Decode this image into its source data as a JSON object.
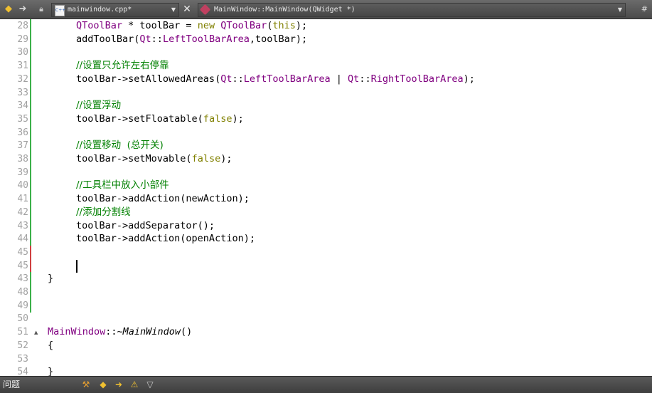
{
  "toolbar": {
    "back_icon": "back-arrow-icon",
    "forward_icon": "forward-arrow-icon",
    "lock_icon": "lock-icon",
    "file_name": "mainwindow.cpp*",
    "file_icon_text": "C++",
    "close_label": "✕",
    "method_name": "MainWindow::MainWindow(QWidget *)",
    "symbol_menu": "#"
  },
  "editor": {
    "lines": [
      {
        "n": "28",
        "mark": "#3cb04a",
        "fold": "",
        "html": "<span class=\"type\">QToolBar</span> * toolBar = <span class=\"kw\">new</span> <span class=\"type\">QToolBar</span>(<span class=\"kw\">this</span>);",
        "indent": true
      },
      {
        "n": "29",
        "mark": "#3cb04a",
        "fold": "",
        "html": "addToolBar(<span class=\"enum\">Qt</span>::<span class=\"enum\">LeftToolBarArea</span>,toolBar);",
        "indent": true
      },
      {
        "n": "30",
        "mark": "#3cb04a",
        "fold": "",
        "html": "",
        "indent": true
      },
      {
        "n": "31",
        "mark": "#3cb04a",
        "fold": "",
        "html": "<span class=\"comment\">//设置只允许左右停靠</span>",
        "indent": true
      },
      {
        "n": "32",
        "mark": "#3cb04a",
        "fold": "",
        "html": "toolBar->setAllowedAreas(<span class=\"enum\">Qt</span>::<span class=\"enum\">LeftToolBarArea</span> | <span class=\"enum\">Qt</span>::<span class=\"enum\">RightToolBarArea</span>);",
        "indent": true
      },
      {
        "n": "33",
        "mark": "#3cb04a",
        "fold": "",
        "html": "",
        "indent": true
      },
      {
        "n": "34",
        "mark": "#3cb04a",
        "fold": "",
        "html": "<span class=\"comment\">//设置浮动</span>",
        "indent": true
      },
      {
        "n": "35",
        "mark": "#3cb04a",
        "fold": "",
        "html": "toolBar->setFloatable(<span class=\"kw\">false</span>);",
        "indent": true
      },
      {
        "n": "36",
        "mark": "#3cb04a",
        "fold": "",
        "html": "",
        "indent": true
      },
      {
        "n": "37",
        "mark": "#3cb04a",
        "fold": "",
        "html": "<span class=\"comment\">//设置移动  (总开关)</span>",
        "indent": true
      },
      {
        "n": "38",
        "mark": "#3cb04a",
        "fold": "",
        "html": "toolBar->setMovable(<span class=\"kw\">false</span>);",
        "indent": true
      },
      {
        "n": "39",
        "mark": "#3cb04a",
        "fold": "",
        "html": "",
        "indent": true
      },
      {
        "n": "40",
        "mark": "#3cb04a",
        "fold": "",
        "html": "<span class=\"comment\">//工具栏中放入小部件</span>",
        "indent": true
      },
      {
        "n": "41",
        "mark": "#3cb04a",
        "fold": "",
        "html": "toolBar->addAction(newAction);",
        "indent": true
      },
      {
        "n": "42",
        "mark": "#3cb04a",
        "fold": "",
        "html": "<span class=\"comment\">//添加分割线</span>",
        "indent": true
      },
      {
        "n": "43",
        "mark": "#3cb04a",
        "fold": "",
        "html": "toolBar->addSeparator();",
        "indent": true
      },
      {
        "n": "44",
        "mark": "#3cb04a",
        "fold": "",
        "html": "toolBar->addAction(openAction);",
        "indent": true
      },
      {
        "n": "45",
        "mark": "#d04040",
        "fold": "",
        "html": "",
        "indent": true
      },
      {
        "n": "45",
        "mark": "#d04040",
        "fold": "",
        "html": "",
        "indent": true
      },
      {
        "n": "43",
        "mark": "#3cb04a",
        "fold": "",
        "html": "}",
        "indent": false
      },
      {
        "n": "48",
        "mark": "#3cb04a",
        "fold": "",
        "html": "",
        "indent": false
      },
      {
        "n": "49",
        "mark": "#3cb04a",
        "fold": "",
        "html": "",
        "indent": false
      },
      {
        "n": "50",
        "mark": "",
        "fold": "",
        "html": "",
        "indent": false
      },
      {
        "n": "51",
        "mark": "",
        "fold": "▲",
        "html": "<span class=\"type\">MainWindow</span>::~<span class=\"fnitalic\">MainWindow</span>()",
        "indent": false
      },
      {
        "n": "52",
        "mark": "",
        "fold": "",
        "html": "{",
        "indent": false
      },
      {
        "n": "53",
        "mark": "",
        "fold": "",
        "html": "",
        "indent": false
      },
      {
        "n": "54",
        "mark": "",
        "fold": "",
        "html": "}",
        "indent": false
      }
    ]
  },
  "statusbar": {
    "label": "问题",
    "icons": [
      "filter-build-icon",
      "previous-issue-icon",
      "next-issue-icon",
      "warning-icon",
      "filter-icon"
    ]
  }
}
